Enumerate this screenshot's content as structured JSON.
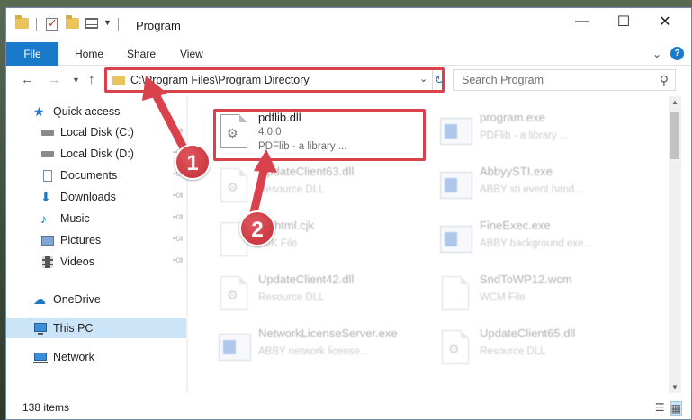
{
  "window": {
    "title": "Program"
  },
  "ribbon": {
    "tabs": [
      "File",
      "Home",
      "Share",
      "View"
    ]
  },
  "address": {
    "path": "C:\\Program Files\\Program Directory",
    "search_placeholder": "Search Program"
  },
  "sidebar": {
    "items": [
      {
        "label": "Quick access",
        "icon": "star-icon",
        "pinned": false
      },
      {
        "label": "Local Disk (C:)",
        "icon": "drive-icon",
        "pinned": true
      },
      {
        "label": "Local Disk (D:)",
        "icon": "drive-icon",
        "pinned": true
      },
      {
        "label": "Documents",
        "icon": "documents-icon",
        "pinned": true
      },
      {
        "label": "Downloads",
        "icon": "download-icon",
        "pinned": true
      },
      {
        "label": "Music",
        "icon": "music-icon",
        "pinned": true
      },
      {
        "label": "Pictures",
        "icon": "pictures-icon",
        "pinned": true
      },
      {
        "label": "Videos",
        "icon": "videos-icon",
        "pinned": true
      },
      {
        "label": "OneDrive",
        "icon": "cloud-icon",
        "pinned": false
      },
      {
        "label": "This PC",
        "icon": "computer-icon",
        "pinned": false,
        "selected": true
      },
      {
        "label": "Network",
        "icon": "network-icon",
        "pinned": false
      }
    ]
  },
  "files": [
    {
      "name": "pdflib.dll",
      "line2": "4.0.0",
      "line3": "PDFlib - a library ...",
      "icon": "dll-icon",
      "highlighted": true
    },
    {
      "name": "program.exe",
      "line2": "PDFlib - a library ...",
      "line3": "",
      "icon": "exe-icon",
      "highlighted": false
    },
    {
      "name": "UpdateClient63.dll",
      "line2": "Resource DLL",
      "line3": "",
      "icon": "dll-icon",
      "highlighted": false
    },
    {
      "name": "AbbyySTI.exe",
      "line2": "ABBY sti event hand...",
      "line3": "",
      "icon": "exe-icon",
      "highlighted": false
    },
    {
      "name": "pdfhtml.cjk",
      "line2": "CJK File",
      "line3": "",
      "icon": "file-icon",
      "highlighted": false
    },
    {
      "name": "FineExec.exe",
      "line2": "ABBY background exe...",
      "line3": "",
      "icon": "exe-icon",
      "highlighted": false
    },
    {
      "name": "UpdateClient42.dll",
      "line2": "Resource DLL",
      "line3": "",
      "icon": "dll-icon",
      "highlighted": false
    },
    {
      "name": "SndToWP12.wcm",
      "line2": "WCM File",
      "line3": "",
      "icon": "file-icon",
      "highlighted": false
    },
    {
      "name": "NetworkLicenseServer.exe",
      "line2": "ABBY network license...",
      "line3": "",
      "icon": "exe-icon",
      "highlighted": false
    },
    {
      "name": "UpdateClient65.dll",
      "line2": "Resource DLL",
      "line3": "",
      "icon": "dll-icon",
      "highlighted": false
    }
  ],
  "status": {
    "items_count": "138 items"
  },
  "callouts": [
    "1",
    "2"
  ],
  "colors": {
    "accent": "#1979ca",
    "highlight": "#d9414c",
    "selected_bg": "#cce4f7"
  }
}
